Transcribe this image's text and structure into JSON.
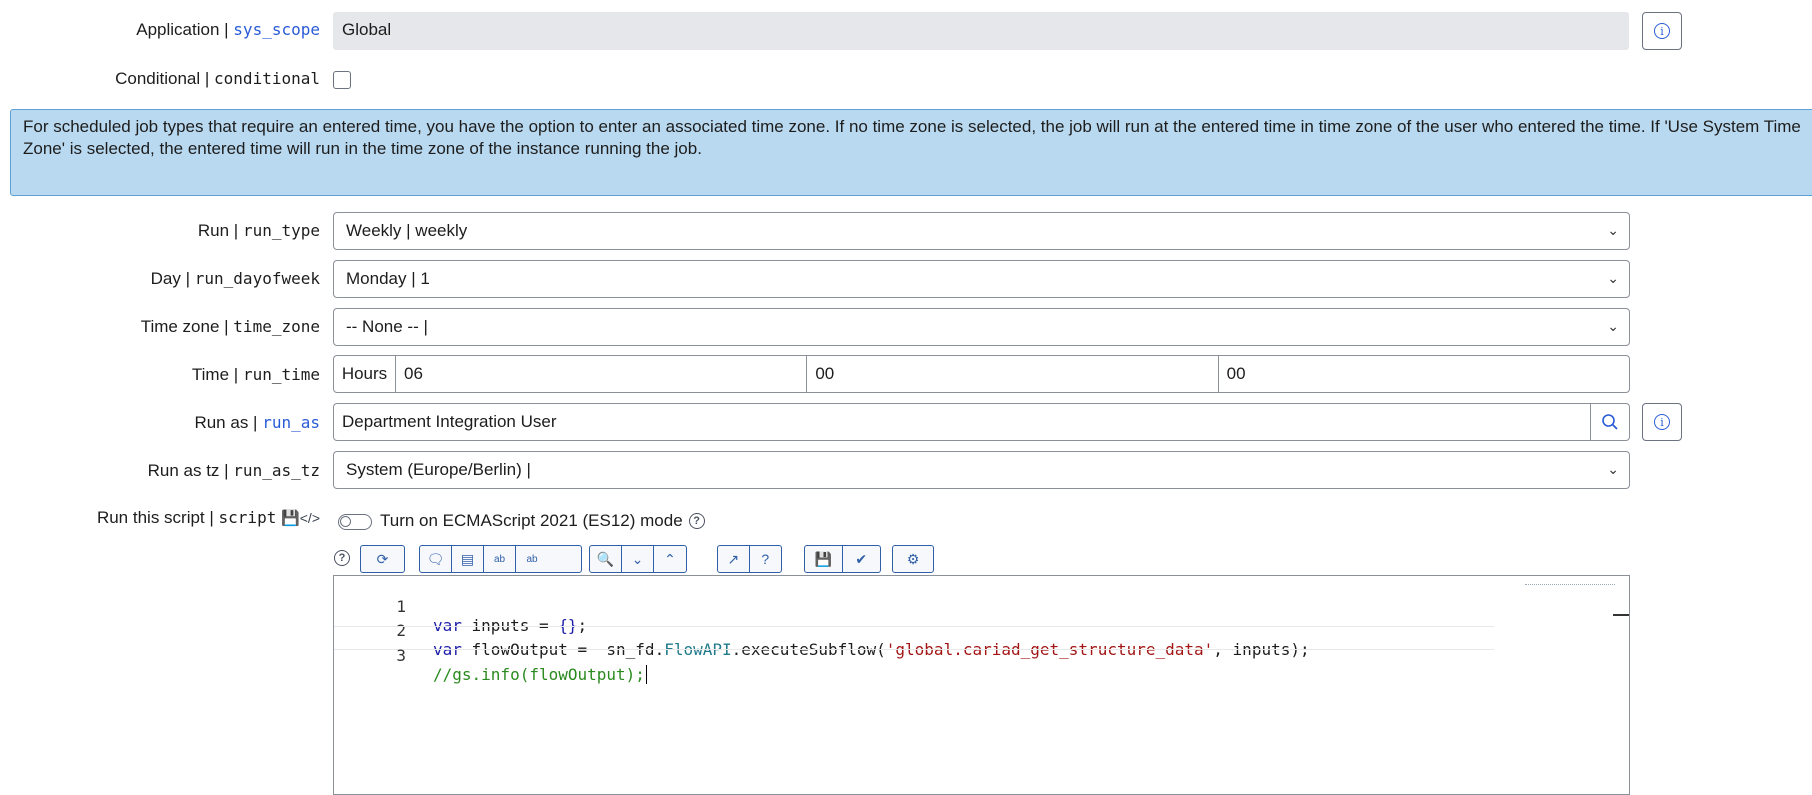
{
  "application": {
    "label": "Application |",
    "field_name": "sys_scope",
    "value": "Global"
  },
  "conditional": {
    "label": "Conditional |",
    "field_name": "conditional"
  },
  "banner": {
    "text": "For scheduled job types that require an entered time, you have the option to enter an associated time zone. If no time zone is selected, the job will run at the entered time in time zone of the user who entered the time. If 'Use System Time Zone' is selected, the entered time will run in the time zone of the instance running the job."
  },
  "run": {
    "label": "Run |",
    "field_name": "run_type",
    "value": "Weekly | weekly"
  },
  "day": {
    "label": "Day |",
    "field_name": "run_dayofweek",
    "value": "Monday | 1"
  },
  "time_zone": {
    "label": "Time zone |",
    "field_name": "time_zone",
    "value": "-- None -- |"
  },
  "time": {
    "label": "Time |",
    "field_name": "run_time",
    "addon": "Hours",
    "hours": "06",
    "minutes": "00",
    "seconds": "00"
  },
  "run_as": {
    "label": "Run as |",
    "field_name": "run_as",
    "value": "Department Integration User"
  },
  "run_as_tz": {
    "label": "Run as tz |",
    "field_name": "run_as_tz",
    "value": "System (Europe/Berlin) |"
  },
  "script": {
    "label": "Run this script |",
    "field_name": "script",
    "es_mode_label": "Turn on ECMAScript 2021 (ES12) mode"
  },
  "code_lines": {
    "l1_num": "1",
    "l2_num": "2",
    "l3_num": "3",
    "l1_kw": "var",
    "l1_rest": " inputs = ",
    "l1_braces": "{}",
    "l1_end": ";",
    "l2_kw": "var",
    "l2_a": " flowOutput =  sn_fd.",
    "l2_type": "FlowAPI",
    "l2_b": ".executeSubflow(",
    "l2_str": "'global.cariad_get_structure_data'",
    "l2_c": ", inputs);",
    "l3_cmt": "//gs.info(flowOutput);"
  },
  "icons": [
    "info-icon",
    "chevron-down-icon",
    "search-icon",
    "toggle",
    "help-icon",
    "format-icon",
    "comment-icon",
    "toggle-comment-icon",
    "replace-icon",
    "replace-all-icon",
    "find-icon",
    "fold-icon",
    "unfold-icon",
    "fullscreen-icon",
    "help-circle-icon",
    "save-icon",
    "script-check-icon",
    "debug-icon"
  ]
}
